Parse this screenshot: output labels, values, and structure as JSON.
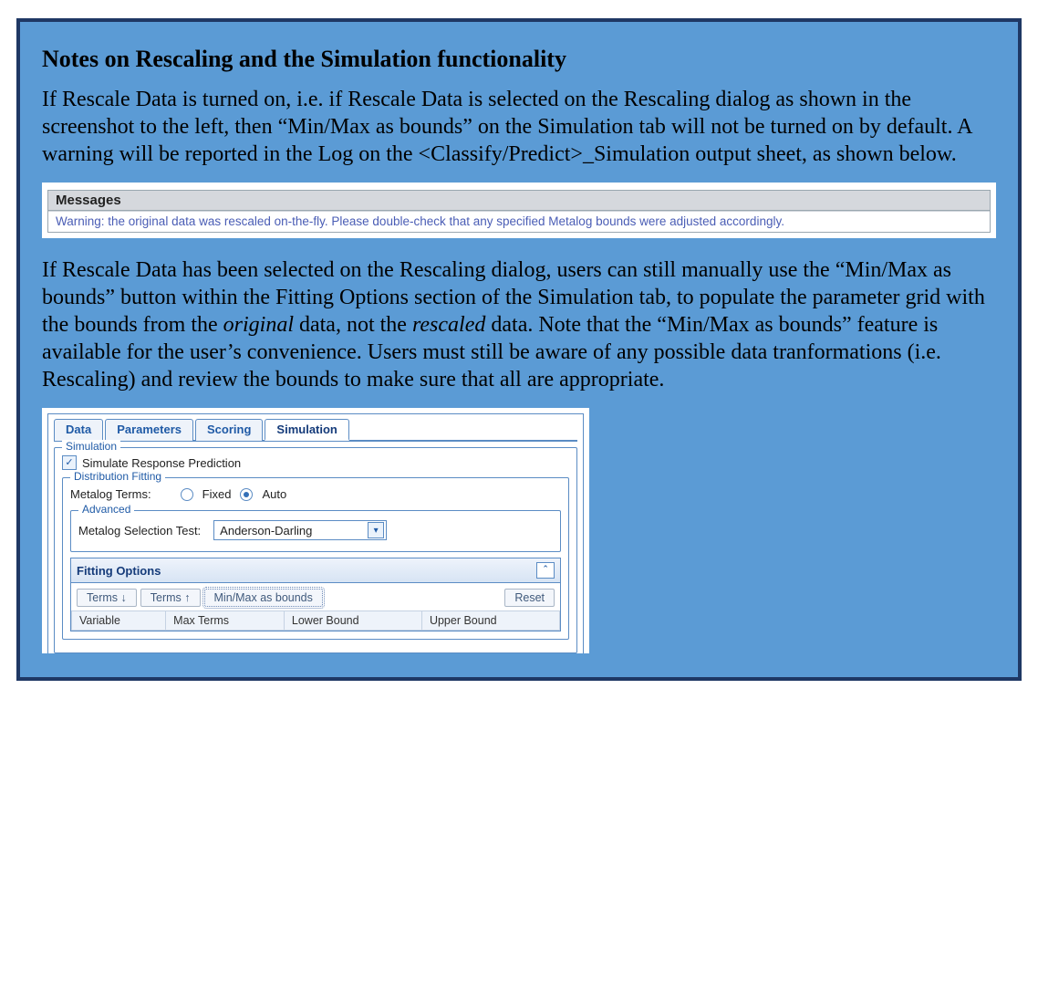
{
  "title": "Notes on Rescaling and the Simulation functionality",
  "para1": "If Rescale Data is turned on, i.e. if Rescale Data is selected on the Rescaling dialog as shown in the screenshot to the left, then “Min/Max as bounds” on the Simulation tab will not be turned on by default.  A warning will be reported in the Log on the <Classify/Predict>_Simulation output sheet, as shown below.",
  "messages": {
    "header": "Messages",
    "warning": "Warning: the original data was rescaled on-the-fly. Please double-check that any specified Metalog bounds were adjusted accordingly."
  },
  "para2_parts": {
    "a": "If Rescale Data has been selected on the Rescaling dialog, users can still manually use the “Min/Max as bounds” button within the Fitting Options section of the Simulation tab, to populate the parameter grid with the bounds from the ",
    "b": "original",
    "c": " data, not the ",
    "d": "rescaled",
    "e": " data.  Note that the “Min/Max as bounds” feature is available for the user’s convenience.  Users must still be aware of any possible data tranformations (i.e. Rescaling) and review the bounds to make sure that all are appropriate."
  },
  "dialog": {
    "tabs": [
      "Data",
      "Parameters",
      "Scoring",
      "Simulation"
    ],
    "active_tab": "Simulation",
    "simulation_legend": "Simulation",
    "simulate_label": "Simulate Response Prediction",
    "dist_fit_legend": "Distribution Fitting",
    "metalog_terms_label": "Metalog Terms:",
    "radio_fixed": "Fixed",
    "radio_auto": "Auto",
    "advanced_legend": "Advanced",
    "selection_test_label": "Metalog Selection Test:",
    "selection_test_value": "Anderson-Darling",
    "fitting_options_title": "Fitting Options",
    "btn_terms_down": "Terms ↓",
    "btn_terms_up": "Terms ↑",
    "btn_minmax": "Min/Max as bounds",
    "btn_reset": "Reset",
    "cols": [
      "Variable",
      "Max Terms",
      "Lower Bound",
      "Upper Bound"
    ]
  }
}
